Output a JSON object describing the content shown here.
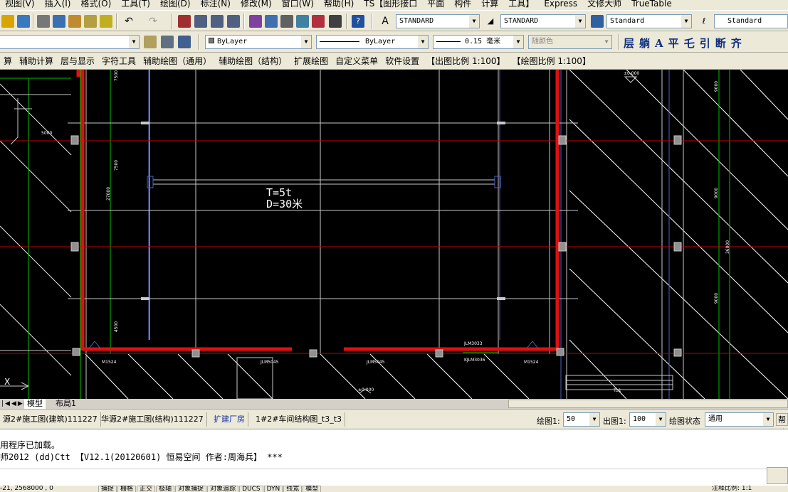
{
  "menu": [
    "视图(V)",
    "插入(I)",
    "格式(O)",
    "工具(T)",
    "绘图(D)",
    "标注(N)",
    "修改(M)",
    "窗口(W)",
    "帮助(H)",
    "TS【图形接口",
    "平面",
    "构件",
    "计算",
    "工具】",
    "Express",
    "文修大师",
    "TrueTable"
  ],
  "toolbar1": {
    "text_style": "STANDARD",
    "dim_style": "STANDARD",
    "table_style": "Standard",
    "ml_style": "Standard"
  },
  "toolbar2": {
    "layer": "ByLayer",
    "linetype": "ByLayer",
    "lineweight": "0.15 毫米",
    "color": "随颜色",
    "tools": [
      "层",
      "躺",
      "A",
      "平",
      "乇",
      "引",
      "断",
      "齐"
    ]
  },
  "toolbar3": [
    "算",
    "辅助计算",
    "层与显示",
    "字符工具",
    "辅助绘图（通用）",
    "辅助绘图（结构）",
    "扩展绘图",
    "自定义菜单",
    "软件设置",
    "【出图比例 1:100】",
    "【绘图比例 1:100】"
  ],
  "drawing": {
    "crane_text1": "T=5t",
    "crane_text2": "D=30米",
    "labels": [
      "M1524",
      "JLM5045",
      "JLM5045",
      "KJLM3036",
      "M1524",
      "JLM3033",
      "±0.000",
      "±0.000",
      "5000",
      "7500",
      "7500",
      "27000",
      "4500",
      "9000",
      "9000",
      "36000",
      "9000",
      "Tz1"
    ]
  },
  "layout_tabs": {
    "model": "模型",
    "layout1": "布局1"
  },
  "docs": [
    "源2#施工图(建筑)111227",
    "华源2#施工图(结构)111227",
    "扩建厂房",
    "1#2#车间结构图_t3_t3"
  ],
  "doc_controls": {
    "draw_label": "绘图1:",
    "draw_value": "50",
    "out_label": "出图1:",
    "out_value": "100",
    "state_label": "绘图状态",
    "state_value": "通用",
    "help": "帮助"
  },
  "command_lines": [
    "用程序已加载。",
    "师2012 (dd)Ctt 【V12.1(20120601) 恒易空间 作者:周海兵】 ***"
  ],
  "status": {
    "coords": "-21,  2568000 ,  0",
    "buttons": [
      "捕捉",
      "栅格",
      "正交",
      "极轴",
      "对象捕捉",
      "对象追踪",
      "DUCS",
      "DYN",
      "线宽",
      "模型"
    ],
    "scale": "注释比例: 1:1"
  },
  "colors": {
    "wall": "#e01010",
    "axis_red": "#c00000",
    "axis_green": "#00c000",
    "grid": "#c8c8c8",
    "canvas": "#000000"
  }
}
